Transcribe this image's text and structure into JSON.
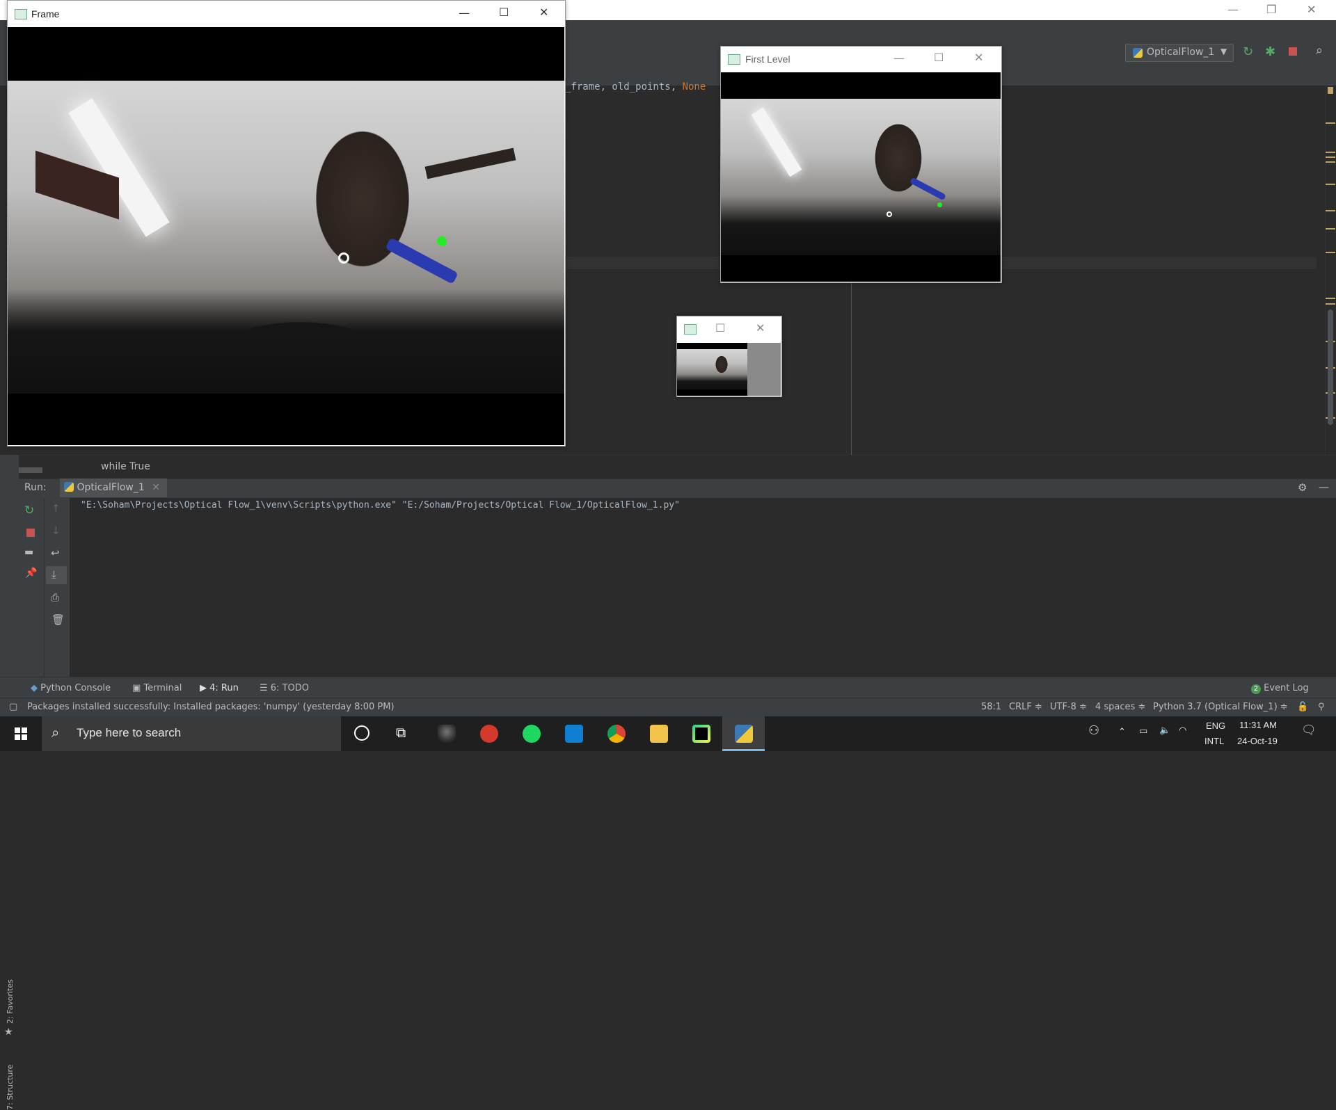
{
  "ide": {
    "run_config": "OpticalFlow_1",
    "code_snippet": "_frame, old_points, ",
    "code_keyword": "None",
    "breadcrumb": "while True",
    "run_label": "Run:",
    "run_tab": "OpticalFlow_1",
    "console_output": "\"E:\\Soham\\Projects\\Optical Flow_1\\venv\\Scripts\\python.exe\" \"E:/Soham/Projects/Optical Flow_1/OpticalFlow_1.py\"",
    "side_tabs": {
      "favorites": "2: Favorites",
      "structure": "7: Structure"
    },
    "tool_tabs": {
      "python_console": "Python Console",
      "terminal": "Terminal",
      "run": "4: Run",
      "todo": "6: TODO",
      "event_log": "Event Log",
      "event_log_count": "2"
    },
    "status": {
      "message": "Packages installed successfully: Installed packages: 'numpy' (yesterday 8:00 PM)",
      "position": "58:1",
      "line_sep": "CRLF ≑",
      "encoding": "UTF-8 ≑",
      "indent": "4 spaces ≑",
      "interpreter": "Python 3.7 (Optical Flow_1) ≑"
    }
  },
  "windows": {
    "frame": {
      "title": "Frame"
    },
    "first_level": {
      "title": "First Level"
    },
    "small": {
      "title": ""
    }
  },
  "taskbar": {
    "search_placeholder": "Type here to search",
    "language_top": "ENG",
    "language_bottom": "INTL",
    "time": "11:31 AM",
    "date": "24-Oct-19"
  },
  "colors": {
    "accent": "#76b9ed",
    "tracked_point": "#22ee22",
    "ide_bg": "#2b2b2b",
    "ide_panel": "#3c3f41"
  }
}
